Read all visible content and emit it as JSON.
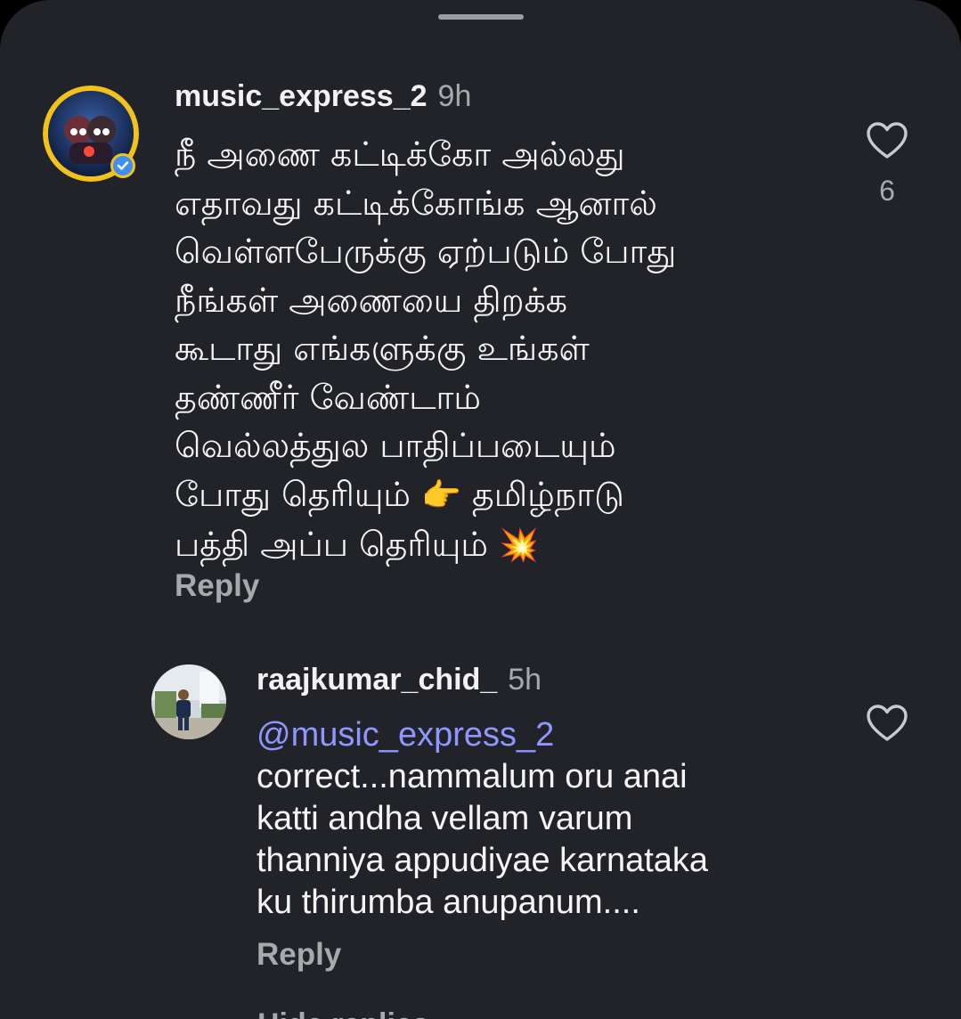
{
  "sheet": {
    "background": "#212328",
    "grabber_color": "#9a9ca2"
  },
  "comments": [
    {
      "username": "music_express_2",
      "time": "9h",
      "text_lines": [
        "நீ அணை கட்டிக்கோ அல்லது",
        "எதாவது கட்டிக்கோங்க ஆனால்",
        "வெள்ளபேருக்கு ஏற்படும் போது",
        "நீங்கள் அணையை திறக்க",
        "கூடாது எங்களுக்கு உங்கள்",
        "தண்ணீர் வேண்டாம்",
        "வெல்லத்துல பாதிப்படையும்",
        "போது தெரியும்",
        "தமிழ்நாடு",
        "பத்தி அப்ப தெரியும்"
      ],
      "emojis": {
        "pointing": "👉",
        "collision": "💥"
      },
      "like_count": "6",
      "reply_label": "Reply",
      "avatar_icon": "cartoon-couple-avatar",
      "verified_icon": "verified-badge-icon"
    },
    {
      "username": "raajkumar_chid_",
      "time": "5h",
      "mention": "@music_express_2",
      "text_lines": [
        "correct...nammalum oru anai",
        "katti andha vellam varum",
        "thanniya appudiyae karnataka",
        "ku thirumba anupanum...."
      ],
      "reply_label": "Reply",
      "avatar_icon": "person-photo-avatar"
    }
  ],
  "footer": {
    "hide_replies_label": "Hide replies"
  },
  "colors": {
    "accent_mention": "#8f96ff",
    "muted_text": "#a8a9ad",
    "primary_text": "#f5f5f5"
  }
}
